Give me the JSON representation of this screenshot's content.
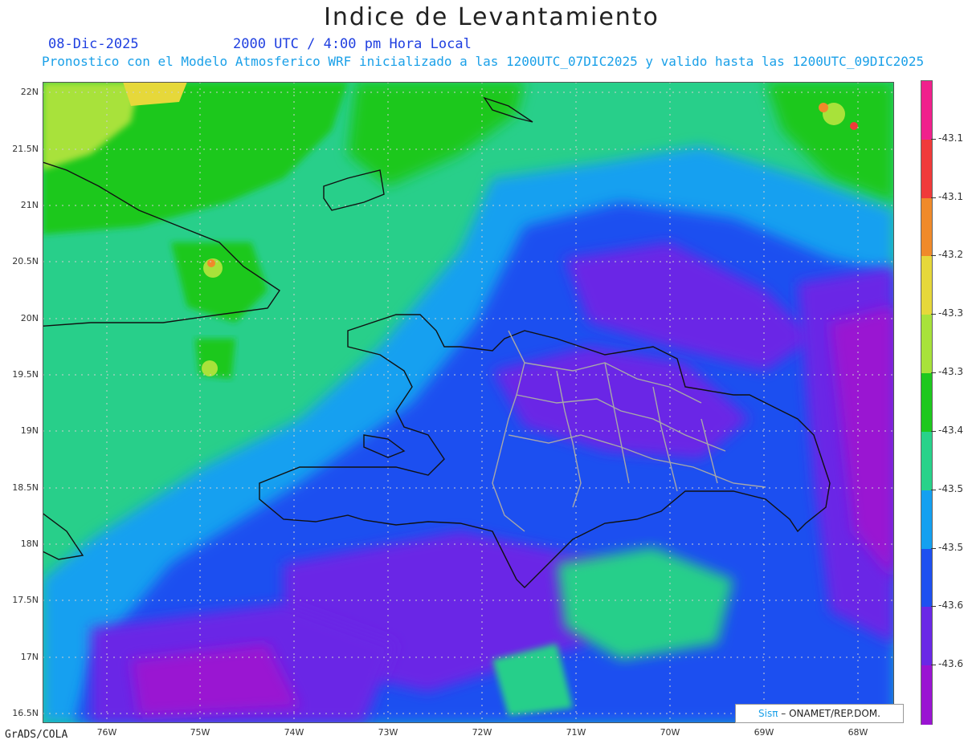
{
  "title": "Indice de Levantamiento",
  "date": "08-Dic-2025",
  "utc_time": "2000 UTC / 4:00 pm Hora Local",
  "subtitle": "Pronostico con el Modelo Atmosferico WRF inicializado a las 1200UTC_07DIC2025 y valido hasta las  1200UTC_09DIC2025",
  "footer_left": "GrADS/COLA",
  "credit": {
    "brand": "Sisπ",
    "text": " – ONAMET/REP.DOM."
  },
  "y_ticks": [
    "22N",
    "21.5N",
    "21N",
    "20.5N",
    "20N",
    "19.5N",
    "19N",
    "18.5N",
    "18N",
    "17.5N",
    "17N",
    "16.5N"
  ],
  "x_ticks": [
    "76W",
    "75W",
    "74W",
    "73W",
    "72W",
    "71W",
    "70W",
    "69W",
    "68W"
  ],
  "colorbar": {
    "labels": [
      "-43.1",
      "-43.1",
      "-43.2",
      "-43.3",
      "-43.3",
      "-43.4",
      "-43.5",
      "-43.5",
      "-43.6",
      "-43.6"
    ],
    "colors": [
      "#f0208c",
      "#f03a3a",
      "#f08a2a",
      "#e6d83a",
      "#a8e23a",
      "#1ec81e",
      "#28d28a",
      "#14a0f0",
      "#1e50f0",
      "#6a28e6",
      "#9a14d2"
    ]
  },
  "colors": {
    "sea_green": "#28cf8a",
    "light_green": "#1ec81e",
    "lime": "#a8e23a",
    "sky_blue": "#14a0f0",
    "blue": "#1e50f0",
    "violet": "#6a28e6",
    "purple": "#9a14d2"
  }
}
